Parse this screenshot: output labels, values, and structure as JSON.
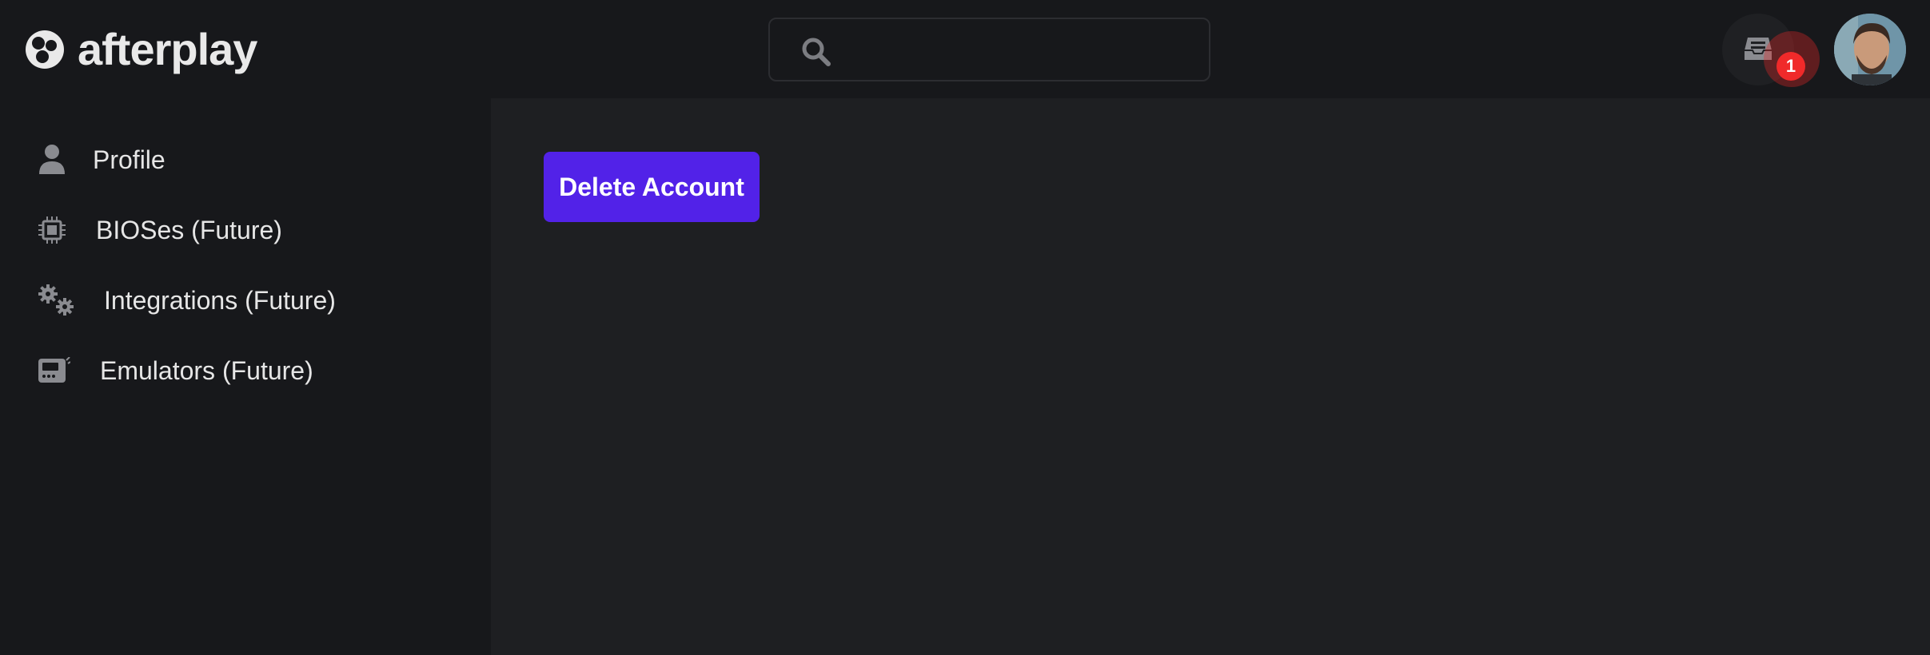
{
  "app": {
    "name": "afterplay"
  },
  "header": {
    "search": {
      "placeholder": "",
      "value": ""
    },
    "notifications": {
      "count": "1"
    },
    "colors": {
      "badge": "#f02a2a",
      "background": "#17181b"
    }
  },
  "sidebar": {
    "items": [
      {
        "label": "Profile",
        "icon": "user-icon"
      },
      {
        "label": "BIOSes (Future)",
        "icon": "chip-icon"
      },
      {
        "label": "Integrations (Future)",
        "icon": "gears-icon"
      },
      {
        "label": "Emulators (Future)",
        "icon": "console-icon"
      }
    ]
  },
  "main": {
    "delete_button_label": "Delete Account",
    "colors": {
      "accent": "#5222e8",
      "background": "#1e1f22"
    }
  }
}
